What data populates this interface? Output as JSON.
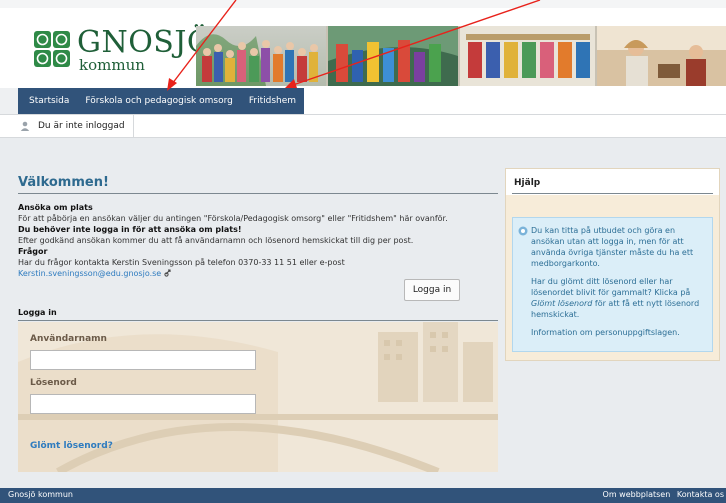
{
  "header": {
    "logo_title": "GNOSJÖ",
    "logo_subtitle": "kommun"
  },
  "nav": {
    "items": [
      {
        "label": "Startsida"
      },
      {
        "label": "Förskola och pedagogisk omsorg"
      },
      {
        "label": "Fritidshem"
      }
    ]
  },
  "status": {
    "text": "Du är inte inloggad"
  },
  "main": {
    "title": "Välkommen!",
    "apply_heading": "Ansöka om plats",
    "apply_text": "För att påbörja en ansökan väljer du antingen \"Förskola/Pedagogisk omsorg\" eller \"Fritidshem\" här ovanför.",
    "no_login_heading": "Du behöver inte logga in för att ansöka om plats!",
    "no_login_text": "Efter godkänd ansökan kommer du att få användarnamn och lösenord hemskickat till dig per post.",
    "questions_heading": "Frågor",
    "questions_text": "Har du frågor kontakta Kerstin Sveningsson på telefon 0370-33 11 51 eller e-post",
    "email": "Kerstin.sveningsson@edu.gnosjo.se"
  },
  "login": {
    "heading": "Logga in",
    "username_label": "Användarnamn",
    "username_value": "",
    "password_label": "Lösenord",
    "password_value": "",
    "forgot_label": "Glömt lösenord?",
    "button_label": "Logga in"
  },
  "help": {
    "title": "Hjälp",
    "p1": "Du kan titta på utbudet och göra en ansökan utan att logga in, men för att använda övriga tjänster måste du ha ett medborgarkonto.",
    "p2a": "Har du glömt ditt lösenord eller har lösenordet blivit för gammalt? Klicka på ",
    "p2_link": "Glömt lösenord",
    "p2b": " för att få ett nytt lösenord hemskickat.",
    "p3": "Information om personuppgiftslagen."
  },
  "footer": {
    "left": "Gnosjö kommun",
    "links": [
      "Om webbplatsen",
      "Kontakta os"
    ]
  },
  "colors": {
    "nav_bg": "#31537a",
    "title_blue": "#2e6a8f",
    "logo_green": "#1f5f38",
    "annotation_red": "#e8221b"
  }
}
